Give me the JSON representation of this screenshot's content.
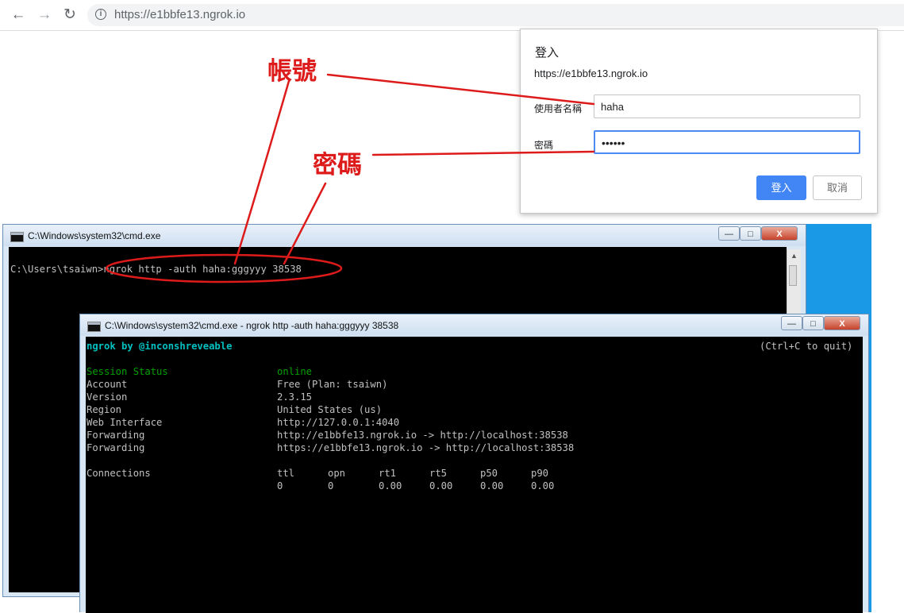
{
  "browser": {
    "url": "https://e1bbfe13.ngrok.io",
    "nav": {
      "back": "←",
      "forward": "→",
      "reload": "↻",
      "info": "i"
    }
  },
  "auth_dialog": {
    "title": "登入",
    "origin": "https://e1bbfe13.ngrok.io",
    "username_label": "使用者名稱",
    "username_value": "haha",
    "password_label": "密碼",
    "password_value": "••••••",
    "login_button": "登入",
    "cancel_button": "取消",
    "accent_color": "#4285f4"
  },
  "cmd1": {
    "title": "C:\\Windows\\system32\\cmd.exe",
    "prompt_line": "C:\\Users\\tsaiwn>ngrok http -auth haha:gggyyy 38538"
  },
  "cmd2": {
    "title": "C:\\Windows\\system32\\cmd.exe - ngrok  http -auth haha:gggyyy 38538",
    "header_left": "ngrok by @inconshreveable",
    "header_right": "(Ctrl+C to quit)",
    "status_rows": [
      {
        "label": "Session Status",
        "value": "online"
      },
      {
        "label": "Account",
        "value": "Free (Plan: tsaiwn)"
      },
      {
        "label": "Version",
        "value": "2.3.15"
      },
      {
        "label": "Region",
        "value": "United States (us)"
      },
      {
        "label": "Web Interface",
        "value": "http://127.0.0.1:4040"
      },
      {
        "label": "Forwarding",
        "value": "http://e1bbfe13.ngrok.io -> http://localhost:38538"
      },
      {
        "label": "Forwarding",
        "value": "https://e1bbfe13.ngrok.io -> http://localhost:38538"
      }
    ],
    "connections_label": "Connections",
    "connections_headers": [
      "ttl",
      "opn",
      "rt1",
      "rt5",
      "p50",
      "p90"
    ],
    "connections_values": [
      "0",
      "0",
      "0.00",
      "0.00",
      "0.00",
      "0.00"
    ],
    "colors": {
      "header_cyan": "#00c0c0",
      "online_green": "#00a000",
      "text_gray": "#c0c0c0"
    }
  },
  "window_buttons": {
    "minimize": "—",
    "maximize": "□",
    "close": "X"
  },
  "annotations": {
    "account_label": "帳號",
    "password_label": "密碼",
    "color": "#dd1b1b"
  }
}
